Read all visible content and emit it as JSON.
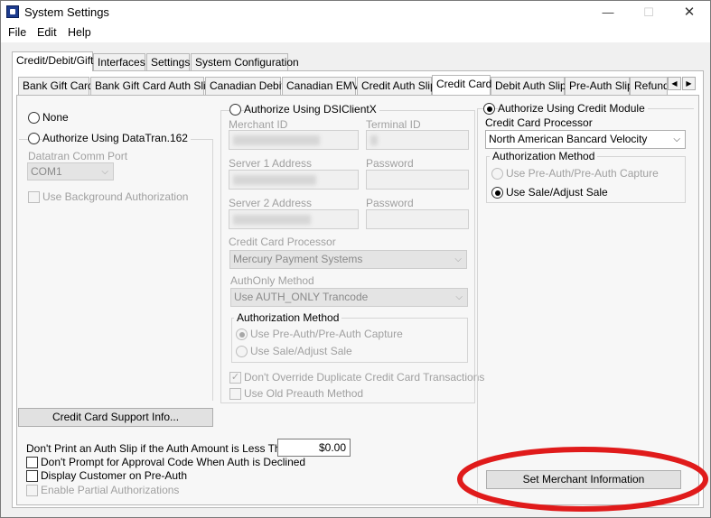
{
  "window": {
    "title": "System Settings",
    "minimize_icon": "minimize-icon",
    "maximize_icon": "maximize-icon",
    "close_icon": "close-icon"
  },
  "menu": {
    "file": "File",
    "edit": "Edit",
    "help": "Help"
  },
  "top_tabs": [
    "Credit/Debit/Gift",
    "Interfaces",
    "Settings",
    "System Configuration"
  ],
  "sub_tabs": [
    "Bank Gift Card",
    "Bank Gift Card Auth Slip",
    "Canadian Debit",
    "Canadian EMV",
    "Credit Auth Slip",
    "Credit Card",
    "Debit Auth Slip",
    "Pre-Auth Slip",
    "Refund"
  ],
  "left": {
    "none_label": "None",
    "datatran_label": "Authorize Using DataTran.162",
    "comm_port_label": "Datatran Comm Port",
    "comm_port_value": "COM1",
    "background_auth_label": "Use Background Authorization",
    "support_button": "Credit Card Support Info..."
  },
  "middle": {
    "dsi_label": "Authorize Using DSIClientX",
    "merchant_id_label": "Merchant ID",
    "terminal_id_label": "Terminal ID",
    "server1_label": "Server 1 Address",
    "password1_label": "Password",
    "server2_label": "Server 2 Address",
    "password2_label": "Password",
    "processor_label": "Credit Card Processor",
    "processor_value": "Mercury Payment Systems",
    "authonly_label": "AuthOnly Method",
    "authonly_value": "Use AUTH_ONLY Trancode",
    "auth_method_title": "Authorization Method",
    "preauth_label": "Use Pre-Auth/Pre-Auth Capture",
    "sale_label": "Use Sale/Adjust Sale",
    "dont_override_label": "Don't Override Duplicate Credit Card Transactions",
    "old_preauth_label": "Use Old Preauth Method"
  },
  "right": {
    "credit_module_label": "Authorize Using Credit Module",
    "processor_label": "Credit Card Processor",
    "processor_value": "North American Bancard Velocity",
    "auth_method_title": "Authorization Method",
    "preauth_label": "Use Pre-Auth/Pre-Auth Capture",
    "sale_label": "Use Sale/Adjust Sale",
    "set_merchant_button": "Set Merchant Information"
  },
  "bottom": {
    "dont_print_label": "Don't Print an Auth Slip if the Auth Amount is Less Than",
    "amount_value": "$0.00",
    "dont_prompt_label": "Don't Prompt for Approval Code When Auth is Declined",
    "display_customer_label": "Display Customer on Pre-Auth",
    "partial_auth_label": "Enable Partial Authorizations"
  },
  "colors": {
    "highlight_ellipse": "#e01b1b"
  }
}
